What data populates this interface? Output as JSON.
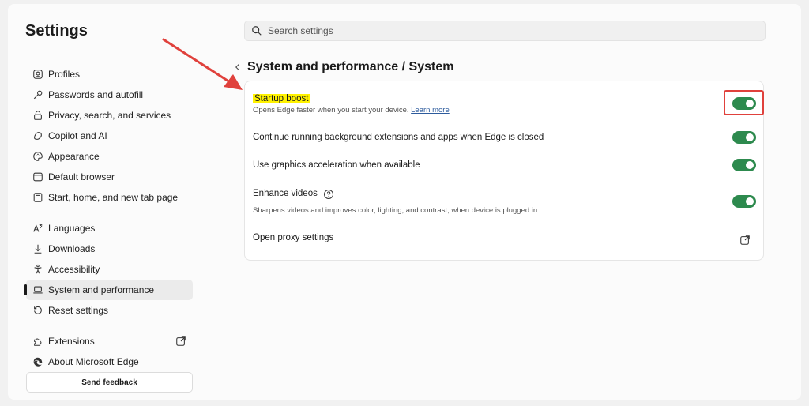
{
  "app": {
    "title": "Settings"
  },
  "search": {
    "placeholder": "Search settings"
  },
  "sidebar": {
    "items": [
      {
        "label": "Profiles",
        "icon": "profile-icon"
      },
      {
        "label": "Passwords and autofill",
        "icon": "key-icon"
      },
      {
        "label": "Privacy, search, and services",
        "icon": "lock-icon"
      },
      {
        "label": "Copilot and AI",
        "icon": "copilot-icon"
      },
      {
        "label": "Appearance",
        "icon": "palette-icon"
      },
      {
        "label": "Default browser",
        "icon": "browser-icon"
      },
      {
        "label": "Start, home, and new tab page",
        "icon": "newtab-icon"
      },
      {
        "label": "Languages",
        "icon": "languages-icon"
      },
      {
        "label": "Downloads",
        "icon": "download-icon"
      },
      {
        "label": "Accessibility",
        "icon": "accessibility-icon"
      },
      {
        "label": "System and performance",
        "icon": "laptop-icon",
        "active": true
      },
      {
        "label": "Reset settings",
        "icon": "reset-icon"
      },
      {
        "label": "Extensions",
        "icon": "extensions-icon"
      },
      {
        "label": "About Microsoft Edge",
        "icon": "edge-icon"
      }
    ],
    "feedback_label": "Send feedback"
  },
  "main": {
    "breadcrumb": "System and performance / System",
    "settings": [
      {
        "label": "Startup boost",
        "description": "Opens Edge faster when you start your device.",
        "link": "Learn more",
        "enabled": true
      },
      {
        "label": "Continue running background extensions and apps when Edge is closed",
        "enabled": true
      },
      {
        "label": "Use graphics acceleration when available",
        "enabled": true
      },
      {
        "label": "Enhance videos",
        "description": "Sharpens videos and improves color, lighting, and contrast, when device is plugged in.",
        "enabled": true
      },
      {
        "label": "Open proxy settings"
      }
    ]
  },
  "colors": {
    "toggle_on": "#2d8a4e",
    "highlight": "#fff200",
    "annotation": "#e0413c"
  }
}
